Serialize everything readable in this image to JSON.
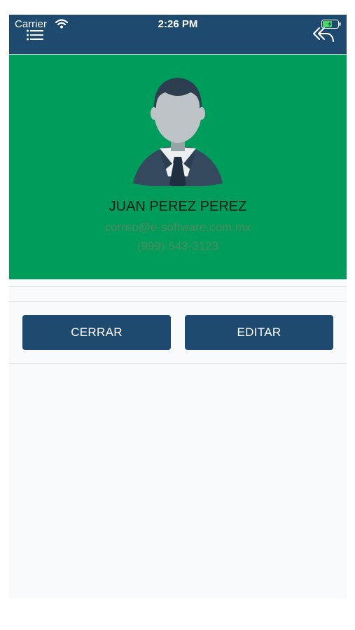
{
  "status_bar": {
    "carrier": "Carrier",
    "time": "2:26 PM"
  },
  "navbar": {
    "menu_icon": "menu-list-icon",
    "back_icon": "reply-back-icon"
  },
  "profile": {
    "name": "JUAN PEREZ PEREZ",
    "email": "correo@e-software.com.mx",
    "phone": "(999) 543-3123",
    "avatar_icon": "businessman-avatar-icon"
  },
  "actions": {
    "close_label": "CERRAR",
    "edit_label": "EDITAR"
  },
  "colors": {
    "navbar": "#1d4a6e",
    "profile_background": "#009c5c",
    "button": "#1d4a6e",
    "content_background": "#f9fafc"
  }
}
